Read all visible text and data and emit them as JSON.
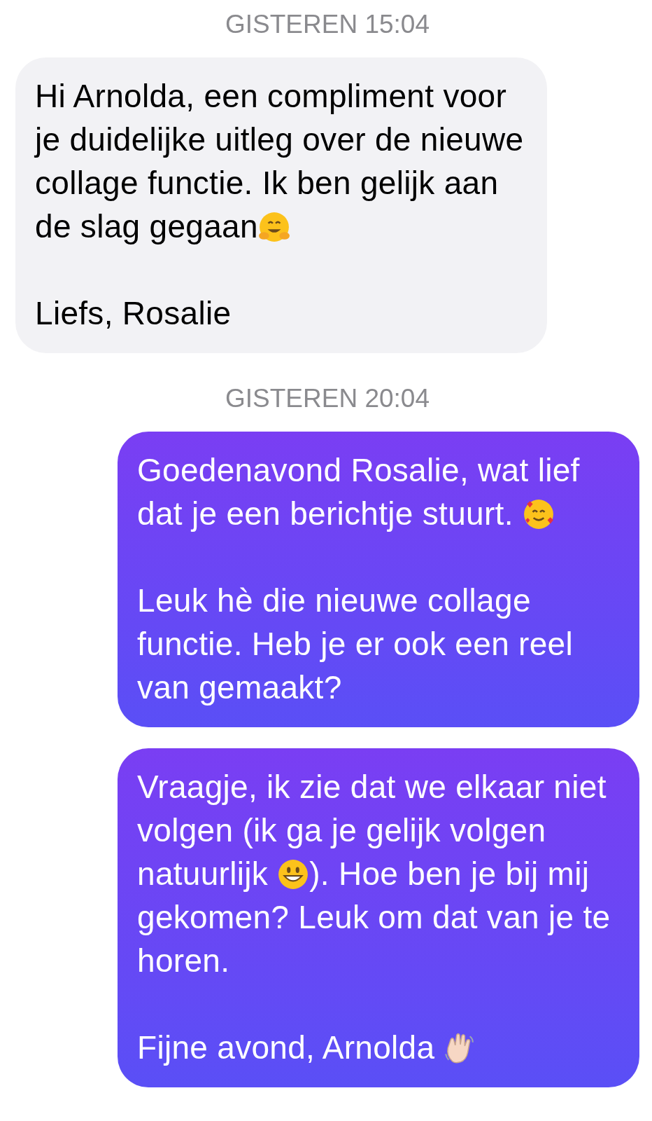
{
  "conversation": [
    {
      "kind": "timestamp",
      "text": "GISTEREN 15:04"
    },
    {
      "kind": "incoming",
      "paragraphs": [
        [
          {
            "kind": "text",
            "text": "Hi Arnolda, een compliment voor je duidelijke uitleg over de nieuwe collage functie. Ik ben gelijk aan de slag gegaan"
          },
          {
            "kind": "hugging_emoji"
          }
        ],
        [
          {
            "kind": "text",
            "text": "Liefs, Rosalie"
          }
        ]
      ]
    },
    {
      "kind": "timestamp",
      "text": "GISTEREN 20:04"
    },
    {
      "kind": "outgoing",
      "paragraphs": [
        [
          {
            "kind": "text",
            "text": "Goedenavond Rosalie, wat lief dat je een berichtje stuurt. "
          },
          {
            "kind": "hearts_emoji"
          }
        ],
        [
          {
            "kind": "text",
            "text": "Leuk hè die nieuwe collage functie. Heb je er ook een reel van gemaakt?"
          }
        ]
      ]
    },
    {
      "kind": "outgoing",
      "paragraphs": [
        [
          {
            "kind": "text",
            "text": "Vraagje, ik zie dat we elkaar niet volgen (ik ga je gelijk volgen natuurlijk "
          },
          {
            "kind": "grin_emoji"
          },
          {
            "kind": "text",
            "text": "). Hoe ben je bij mij gekomen? Leuk om dat van je te horen."
          }
        ],
        [
          {
            "kind": "text",
            "text": "Fijne avond, Arnolda "
          },
          {
            "kind": "wave_emoji"
          }
        ]
      ]
    }
  ]
}
